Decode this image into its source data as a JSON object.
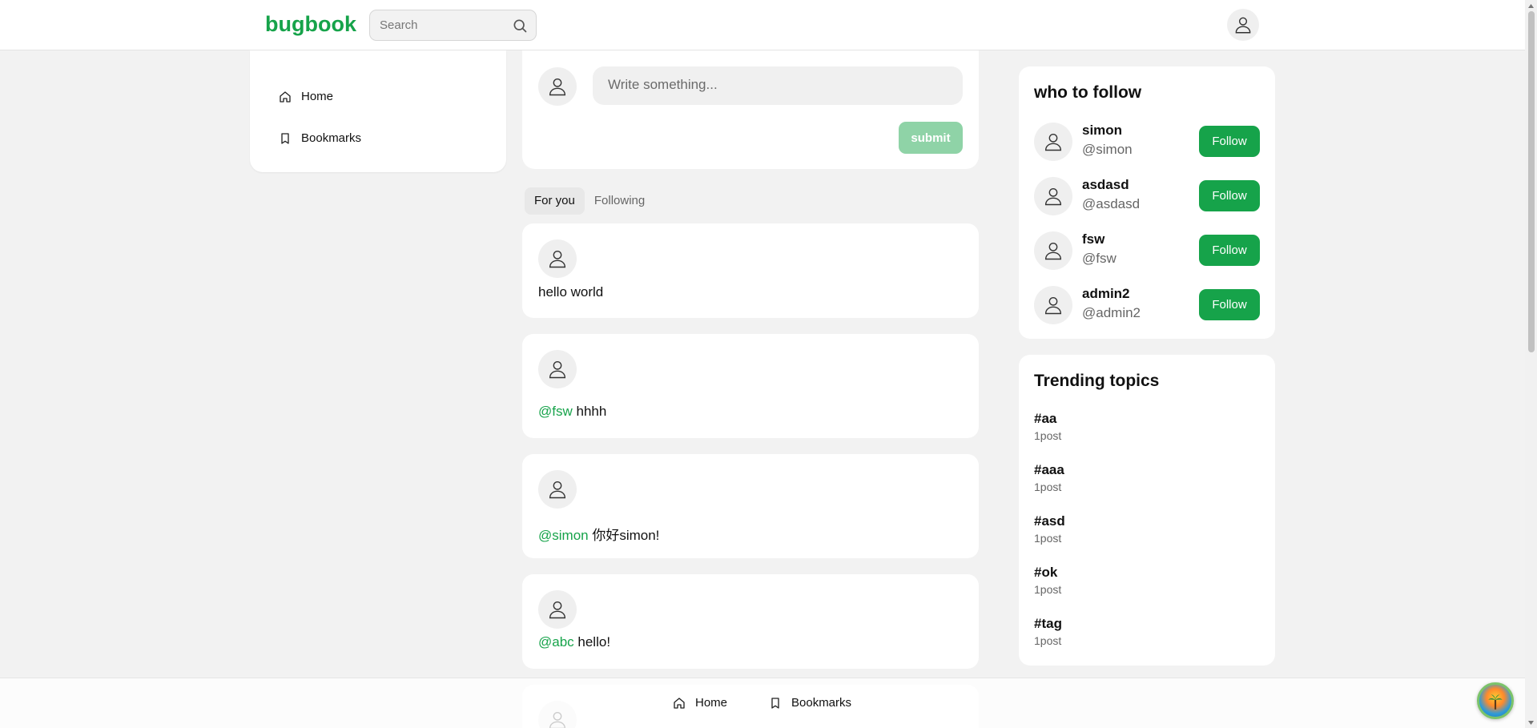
{
  "app": {
    "logo": "bugbook",
    "brand_color": "#16a34a"
  },
  "header": {
    "search_placeholder": "Search"
  },
  "nav": {
    "home": "Home",
    "bookmarks": "Bookmarks"
  },
  "composer": {
    "placeholder": "Write something...",
    "submit_label": "submit"
  },
  "feed": {
    "tabs": [
      {
        "label": "For you",
        "active": true
      },
      {
        "label": "Following",
        "active": false
      }
    ],
    "posts": [
      {
        "mention": "",
        "text": "hello world"
      },
      {
        "mention": "@fsw",
        "text": " hhhh"
      },
      {
        "mention": "@simon",
        "text": " 你好simon!"
      },
      {
        "mention": "@abc",
        "text": " hello!"
      }
    ]
  },
  "who_to_follow": {
    "title": "who to follow",
    "follow_label": "Follow",
    "users": [
      {
        "name": "simon",
        "handle": "@simon"
      },
      {
        "name": "asdasd",
        "handle": "@asdasd"
      },
      {
        "name": "fsw",
        "handle": "@fsw"
      },
      {
        "name": "admin2",
        "handle": "@admin2"
      }
    ]
  },
  "trending": {
    "title": "Trending topics",
    "topics": [
      {
        "tag": "#aa",
        "count": "1post"
      },
      {
        "tag": "#aaa",
        "count": "1post"
      },
      {
        "tag": "#asd",
        "count": "1post"
      },
      {
        "tag": "#ok",
        "count": "1post"
      },
      {
        "tag": "#tag",
        "count": "1post"
      }
    ]
  },
  "bottom_nav": {
    "home": "Home",
    "bookmarks": "Bookmarks"
  },
  "icons": {
    "search": "search-icon",
    "user": "user-avatar-icon",
    "home": "home-icon",
    "bookmark": "bookmark-icon"
  }
}
